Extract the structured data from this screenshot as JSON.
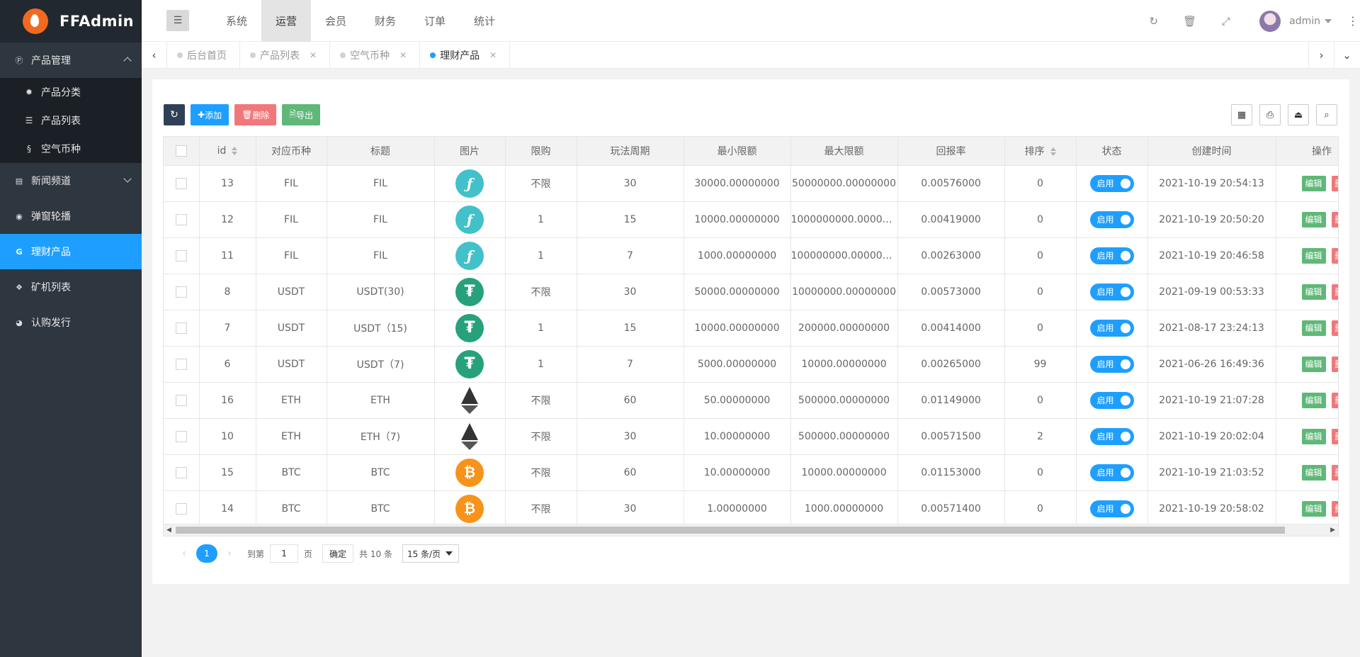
{
  "app": {
    "logo_text": "FFAdmin"
  },
  "sidebar": {
    "items": [
      {
        "label": "产品管理",
        "icon": "p-circle-icon",
        "expanded": true,
        "children": [
          {
            "label": "产品分类",
            "icon": "gear-icon"
          },
          {
            "label": "产品列表",
            "icon": "list-icon"
          },
          {
            "label": "空气币种",
            "icon": "coin-icon"
          }
        ]
      },
      {
        "label": "新闻频道",
        "icon": "news-icon"
      },
      {
        "label": "弹窗轮播",
        "icon": "compass-icon"
      },
      {
        "label": "理财产品",
        "icon": "g-icon",
        "active": true
      },
      {
        "label": "矿机列表",
        "icon": "cubes-icon"
      },
      {
        "label": "认购发行",
        "icon": "pie-chart-icon"
      }
    ]
  },
  "header": {
    "nav": [
      "系统",
      "运营",
      "会员",
      "财务",
      "订单",
      "统计"
    ],
    "active_nav": "运营",
    "user": "admin"
  },
  "tabs": [
    {
      "label": "后台首页",
      "closable": false
    },
    {
      "label": "产品列表",
      "closable": true
    },
    {
      "label": "空气币种",
      "closable": true
    },
    {
      "label": "理财产品",
      "closable": true,
      "active": true
    }
  ],
  "toolbar": {
    "add_label": "添加",
    "delete_label": "删除",
    "export_label": "导出"
  },
  "table": {
    "columns": [
      "id",
      "对应币种",
      "标题",
      "图片",
      "限购",
      "玩法周期",
      "最小限额",
      "最大限额",
      "回报率",
      "排序",
      "状态",
      "创建时间",
      "操作"
    ],
    "rows": [
      {
        "id": "13",
        "coin": "FIL",
        "title": "FIL",
        "img": "fil",
        "limit": "不限",
        "cycle": "30",
        "min": "30000.00000000",
        "max": "50000000.00000000",
        "rate": "0.00576000",
        "sort": "0",
        "status": "启用",
        "created": "2021-10-19 20:54:13"
      },
      {
        "id": "12",
        "coin": "FIL",
        "title": "FIL",
        "img": "fil",
        "limit": "1",
        "cycle": "15",
        "min": "10000.00000000",
        "max": "1000000000.00000000",
        "rate": "0.00419000",
        "sort": "0",
        "status": "启用",
        "created": "2021-10-19 20:50:20"
      },
      {
        "id": "11",
        "coin": "FIL",
        "title": "FIL",
        "img": "fil",
        "limit": "1",
        "cycle": "7",
        "min": "1000.00000000",
        "max": "100000000.00000000",
        "rate": "0.00263000",
        "sort": "0",
        "status": "启用",
        "created": "2021-10-19 20:46:58"
      },
      {
        "id": "8",
        "coin": "USDT",
        "title": "USDT(30)",
        "img": "usdt",
        "limit": "不限",
        "cycle": "30",
        "min": "50000.00000000",
        "max": "10000000.00000000",
        "rate": "0.00573000",
        "sort": "0",
        "status": "启用",
        "created": "2021-09-19 00:53:33"
      },
      {
        "id": "7",
        "coin": "USDT",
        "title": "USDT（15)",
        "img": "usdt",
        "limit": "1",
        "cycle": "15",
        "min": "10000.00000000",
        "max": "200000.00000000",
        "rate": "0.00414000",
        "sort": "0",
        "status": "启用",
        "created": "2021-08-17 23:24:13"
      },
      {
        "id": "6",
        "coin": "USDT",
        "title": "USDT（7)",
        "img": "usdt",
        "limit": "1",
        "cycle": "7",
        "min": "5000.00000000",
        "max": "10000.00000000",
        "rate": "0.00265000",
        "sort": "99",
        "status": "启用",
        "created": "2021-06-26 16:49:36"
      },
      {
        "id": "16",
        "coin": "ETH",
        "title": "ETH",
        "img": "eth",
        "limit": "不限",
        "cycle": "60",
        "min": "50.00000000",
        "max": "500000.00000000",
        "rate": "0.01149000",
        "sort": "0",
        "status": "启用",
        "created": "2021-10-19 21:07:28"
      },
      {
        "id": "10",
        "coin": "ETH",
        "title": "ETH（7)",
        "img": "eth",
        "limit": "不限",
        "cycle": "30",
        "min": "10.00000000",
        "max": "500000.00000000",
        "rate": "0.00571500",
        "sort": "2",
        "status": "启用",
        "created": "2021-10-19 20:02:04"
      },
      {
        "id": "15",
        "coin": "BTC",
        "title": "BTC",
        "img": "btc",
        "limit": "不限",
        "cycle": "60",
        "min": "10.00000000",
        "max": "10000.00000000",
        "rate": "0.01153000",
        "sort": "0",
        "status": "启用",
        "created": "2021-10-19 21:03:52"
      },
      {
        "id": "14",
        "coin": "BTC",
        "title": "BTC",
        "img": "btc",
        "limit": "不限",
        "cycle": "30",
        "min": "1.00000000",
        "max": "1000.00000000",
        "rate": "0.00571400",
        "sort": "0",
        "status": "启用",
        "created": "2021-10-19 20:58:02"
      }
    ],
    "edit_label": "编辑",
    "delete_label": "删除"
  },
  "pager": {
    "current": "1",
    "goto_label": "到第",
    "page_input": "1",
    "page_unit": "页",
    "confirm_label": "确定",
    "total_label": "共 10 条",
    "page_size": "15 条/页"
  },
  "colors": {
    "accent": "#1e9fff",
    "sidebar": "#2e363f",
    "success": "#5fb878",
    "danger": "#f0787a"
  }
}
